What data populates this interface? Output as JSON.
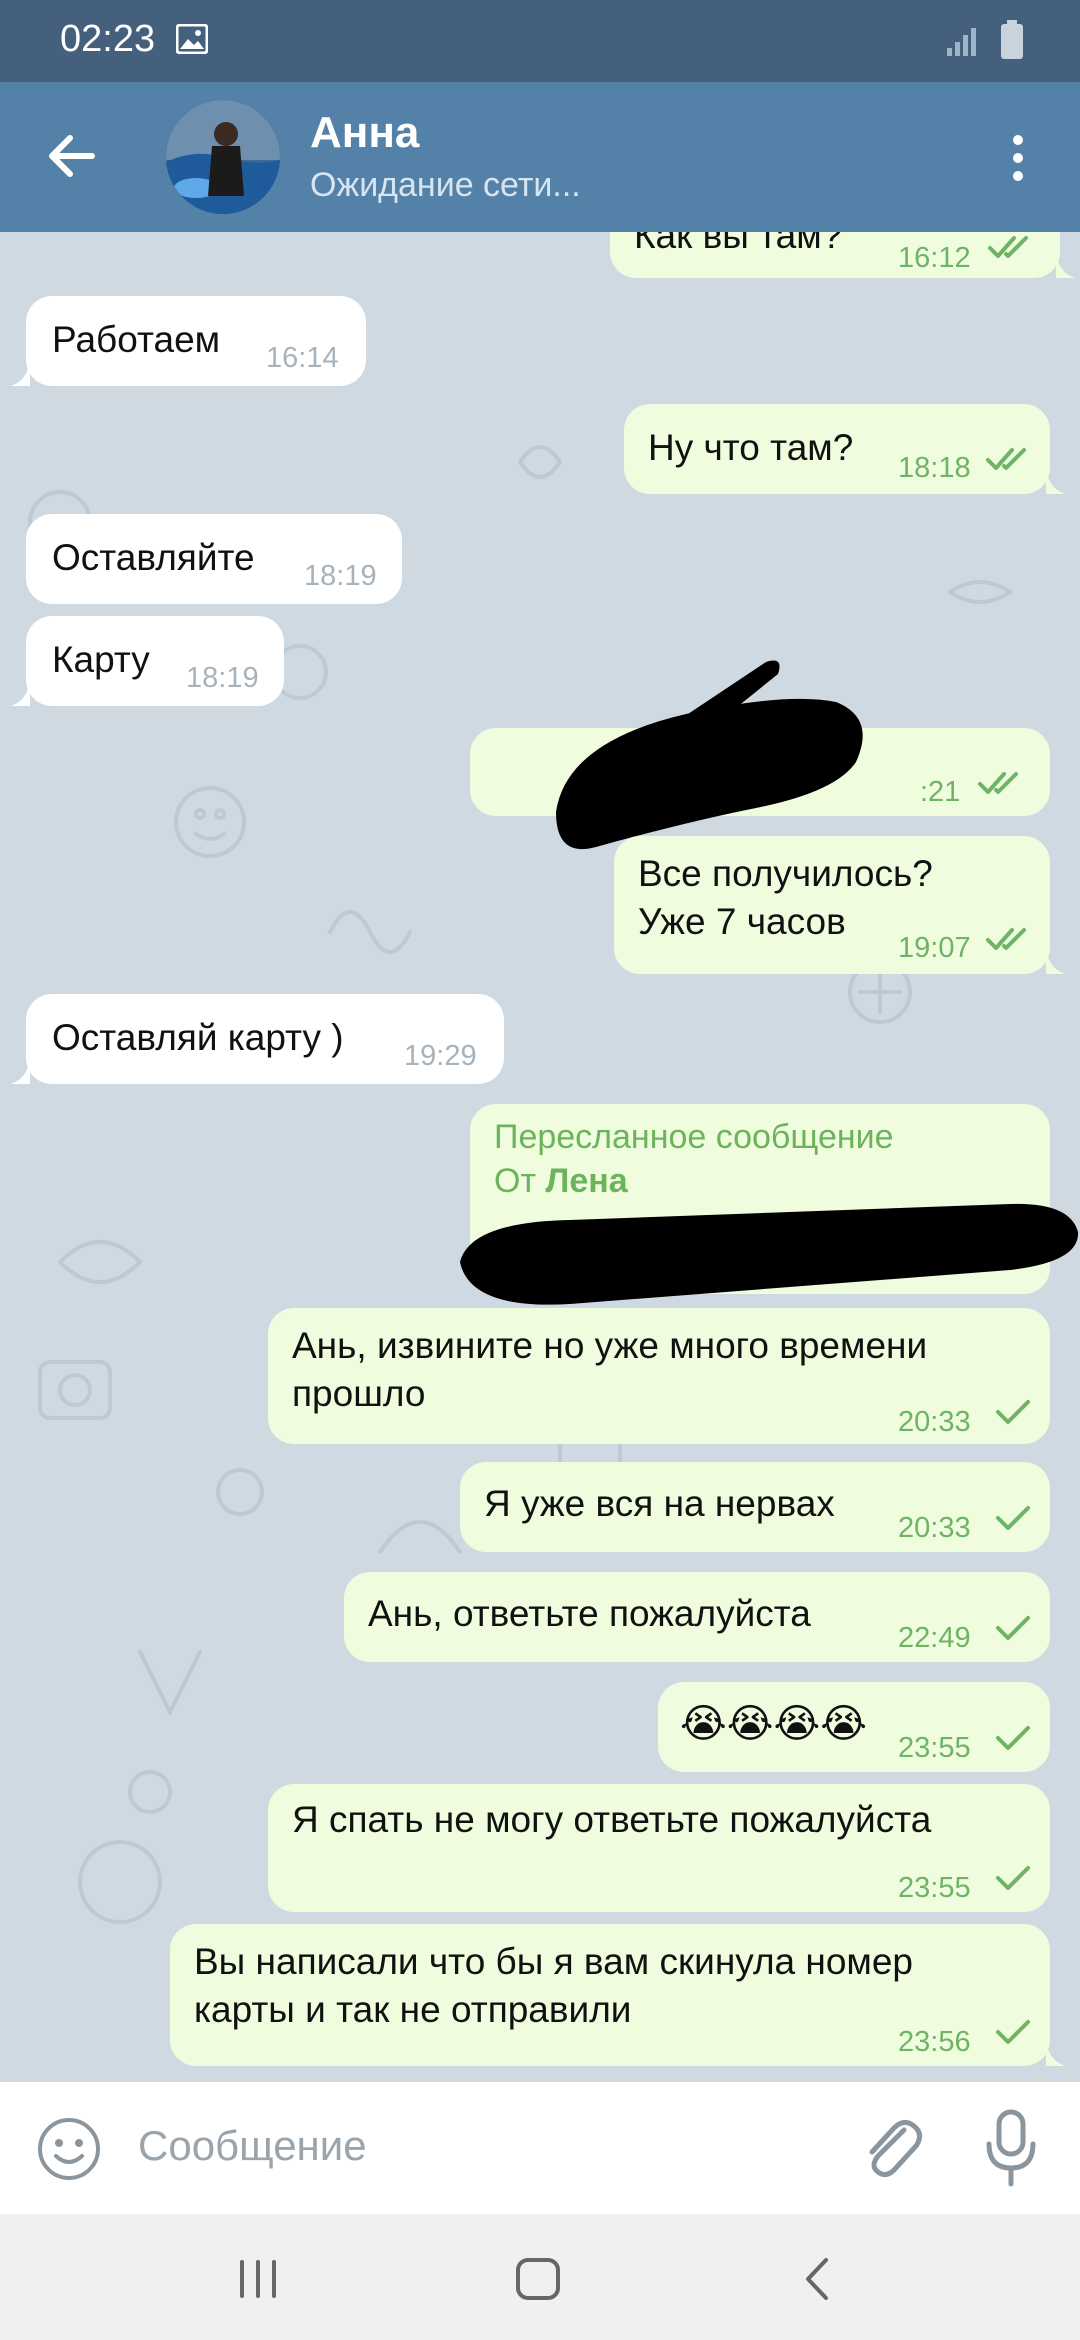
{
  "status_bar": {
    "time": "02:23"
  },
  "header": {
    "title": "Анна",
    "subtitle": "Ожидание сети..."
  },
  "messages": [
    {
      "direction": "out",
      "text": "Как вы там?",
      "time": "16:12",
      "ticks": "double"
    },
    {
      "direction": "in",
      "text": "Работаем",
      "time": "16:14"
    },
    {
      "direction": "out",
      "text": "Ну что там?",
      "time": "18:18",
      "ticks": "double"
    },
    {
      "direction": "in",
      "text": "Оставляйте",
      "time": "18:19"
    },
    {
      "direction": "in",
      "text": "Карту",
      "time": "18:19"
    },
    {
      "direction": "out",
      "text": "",
      "time": "18:21",
      "time_visible": ":21",
      "ticks": "double",
      "redacted": true
    },
    {
      "direction": "out",
      "line1": "Все получилось?",
      "line2": "Уже 7 часов",
      "time": "19:07",
      "ticks": "double"
    },
    {
      "direction": "in",
      "text": "Оставляй карту )",
      "time": "19:29"
    },
    {
      "direction": "out",
      "forwarded": true,
      "label": "Пересланное сообщение",
      "from_prefix": "От",
      "from_name": "Лена",
      "redacted": true
    },
    {
      "direction": "out",
      "line1": "Ань, извините но уже много времени",
      "line2": "прошло",
      "time": "20:33",
      "ticks": "single"
    },
    {
      "direction": "out",
      "text": "Я уже вся на нервах",
      "time": "20:33",
      "ticks": "single"
    },
    {
      "direction": "out",
      "text": "Ань, ответьте пожалуйста",
      "time": "22:49",
      "ticks": "single"
    },
    {
      "direction": "out",
      "text": "😭😭😭😭",
      "time": "23:55",
      "ticks": "single"
    },
    {
      "direction": "out",
      "text": "Я спать не могу ответьте пожалуйста",
      "time": "23:55",
      "ticks": "single"
    },
    {
      "direction": "out",
      "line1": "Вы написали что бы я вам скинула номер",
      "line2": "карты и так не отправили",
      "time": "23:56",
      "ticks": "single"
    }
  ],
  "composer": {
    "placeholder": "Сообщение"
  },
  "colors": {
    "header": "#5481a8",
    "status_bar": "#44607c",
    "outgoing_bubble": "#effdde",
    "incoming_bubble": "#ffffff",
    "tick": "#6fb366",
    "chat_bg": "#cfd9e2"
  },
  "icons": [
    "back-arrow-icon",
    "more-vert-icon",
    "emoji-icon",
    "attach-icon",
    "mic-icon",
    "recents-icon",
    "home-icon",
    "nav-back-icon"
  ]
}
